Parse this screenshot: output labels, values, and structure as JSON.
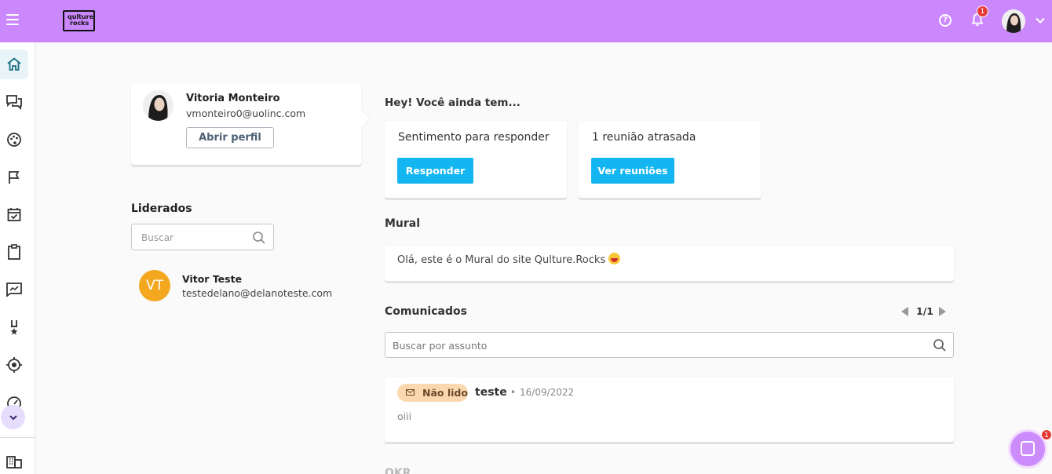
{
  "brand": {
    "logo_line1": "qulture",
    "logo_line2": "rocks"
  },
  "header": {
    "help_icon": "help-circle-icon",
    "help_glyph": "?",
    "notifications_count": "1",
    "menu_icon": "hamburger-icon"
  },
  "sidebar": {
    "items": [
      {
        "icon": "home-icon",
        "active": true
      },
      {
        "icon": "chat-bubbles-icon"
      },
      {
        "icon": "palette-icon"
      },
      {
        "icon": "flag-icon"
      },
      {
        "icon": "calendar-check-icon"
      },
      {
        "icon": "clipboard-icon"
      },
      {
        "icon": "chart-chat-icon"
      },
      {
        "icon": "medal-icon"
      },
      {
        "icon": "target-icon"
      },
      {
        "icon": "gauge-icon"
      },
      {
        "icon": "building-icon"
      }
    ]
  },
  "profile": {
    "name": "Vitoria Monteiro",
    "email": "vmonteiro0@uolinc.com",
    "button": "Abrir perfil"
  },
  "liderados": {
    "title": "Liderados",
    "search_placeholder": "Buscar",
    "people": [
      {
        "initials": "VT",
        "name": "Vitor Teste",
        "email": "testedelano@delanoteste.com"
      }
    ]
  },
  "pending": {
    "title": "Hey! Você ainda tem...",
    "cards": [
      {
        "text": "Sentimento para responder",
        "button": "Responder"
      },
      {
        "text": "1 reunião atrasada",
        "button": "Ver reuniões"
      }
    ]
  },
  "mural": {
    "title": "Mural",
    "text": "Olá, este é o Mural do site Qulture.Rocks"
  },
  "comunicados": {
    "title": "Comunicados",
    "pager": "1/1",
    "search_placeholder": "Buscar por assunto",
    "items": [
      {
        "badge": "Não lido",
        "title": "teste",
        "dot": "•",
        "date": "16/09/2022",
        "body": "oiii"
      }
    ]
  },
  "next_section_title": "OKR",
  "chat": {
    "badge": "1"
  },
  "colors": {
    "topbar": "#ca88fc",
    "primary_button": "#13b6f0",
    "badge": "#fbd8b0",
    "avatar_vt": "#f3a81f"
  }
}
